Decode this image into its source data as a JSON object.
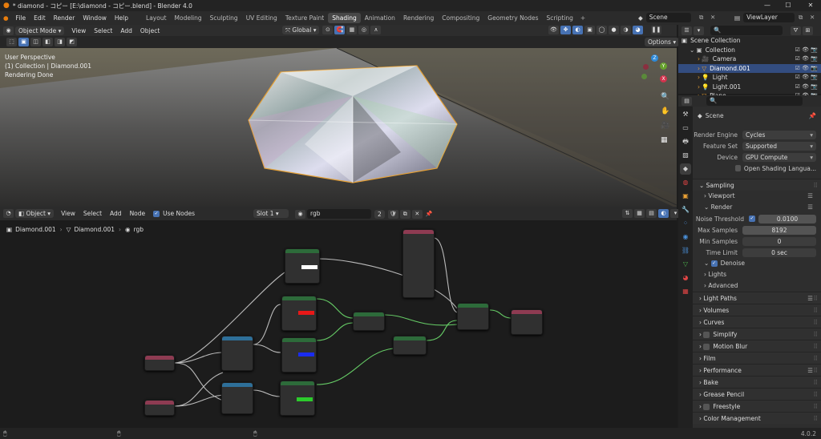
{
  "window": {
    "title": "* diamond - コピー [E:\\diamond - コピー.blend] - Blender 4.0"
  },
  "menu": [
    "File",
    "Edit",
    "Render",
    "Window",
    "Help"
  ],
  "workspaces": [
    "Layout",
    "Modeling",
    "Sculpting",
    "UV Editing",
    "Texture Paint",
    "Shading",
    "Animation",
    "Rendering",
    "Compositing",
    "Geometry Nodes",
    "Scripting"
  ],
  "active_workspace": "Shading",
  "scene": {
    "name": "Scene",
    "view_layer": "ViewLayer"
  },
  "viewport": {
    "mode": "Object Mode",
    "menus": [
      "View",
      "Select",
      "Add",
      "Object"
    ],
    "orientation": "Global",
    "options_label": "Options",
    "info": [
      "User Perspective",
      "(1) Collection | Diamond.001",
      "Rendering Done"
    ],
    "gizmo": {
      "z": "Z",
      "y": "Y",
      "x": "X"
    }
  },
  "node_editor": {
    "type": "Object",
    "menus": [
      "View",
      "Select",
      "Add",
      "Node"
    ],
    "use_nodes_label": "Use Nodes",
    "slot": "Slot 1",
    "material": "rgb",
    "users": "2",
    "breadcrumb": [
      "Diamond.001",
      "Diamond.001",
      "rgb"
    ]
  },
  "outliner": {
    "root": "Scene Collection",
    "items": [
      {
        "name": "Collection",
        "selected": false
      },
      {
        "name": "Camera",
        "selected": false
      },
      {
        "name": "Diamond.001",
        "selected": true
      },
      {
        "name": "Light",
        "selected": false
      },
      {
        "name": "Light.001",
        "selected": false
      },
      {
        "name": "Plane",
        "selected": false
      }
    ]
  },
  "properties": {
    "context": "Scene",
    "render_engine": {
      "label": "Render Engine",
      "value": "Cycles"
    },
    "feature_set": {
      "label": "Feature Set",
      "value": "Supported"
    },
    "device": {
      "label": "Device",
      "value": "GPU Compute"
    },
    "osl_label": "Open Shading Langua...",
    "sampling": "Sampling",
    "viewport": "Viewport",
    "render": "Render",
    "noise_threshold": {
      "label": "Noise Threshold",
      "value": "0.0100"
    },
    "max_samples": {
      "label": "Max Samples",
      "value": "8192"
    },
    "min_samples": {
      "label": "Min Samples",
      "value": "0"
    },
    "time_limit": {
      "label": "Time Limit",
      "value": "0 sec"
    },
    "denoise": "Denoise",
    "lights": "Lights",
    "advanced": "Advanced",
    "sections": [
      "Light Paths",
      "Volumes",
      "Curves",
      "Simplify",
      "Motion Blur",
      "Film",
      "Performance",
      "Bake",
      "Grease Pencil",
      "Freestyle",
      "Color Management"
    ]
  },
  "status": {
    "version": "4.0.2"
  },
  "colors": {
    "accent": "#4772b3",
    "selection_orange": "#e5a035"
  }
}
